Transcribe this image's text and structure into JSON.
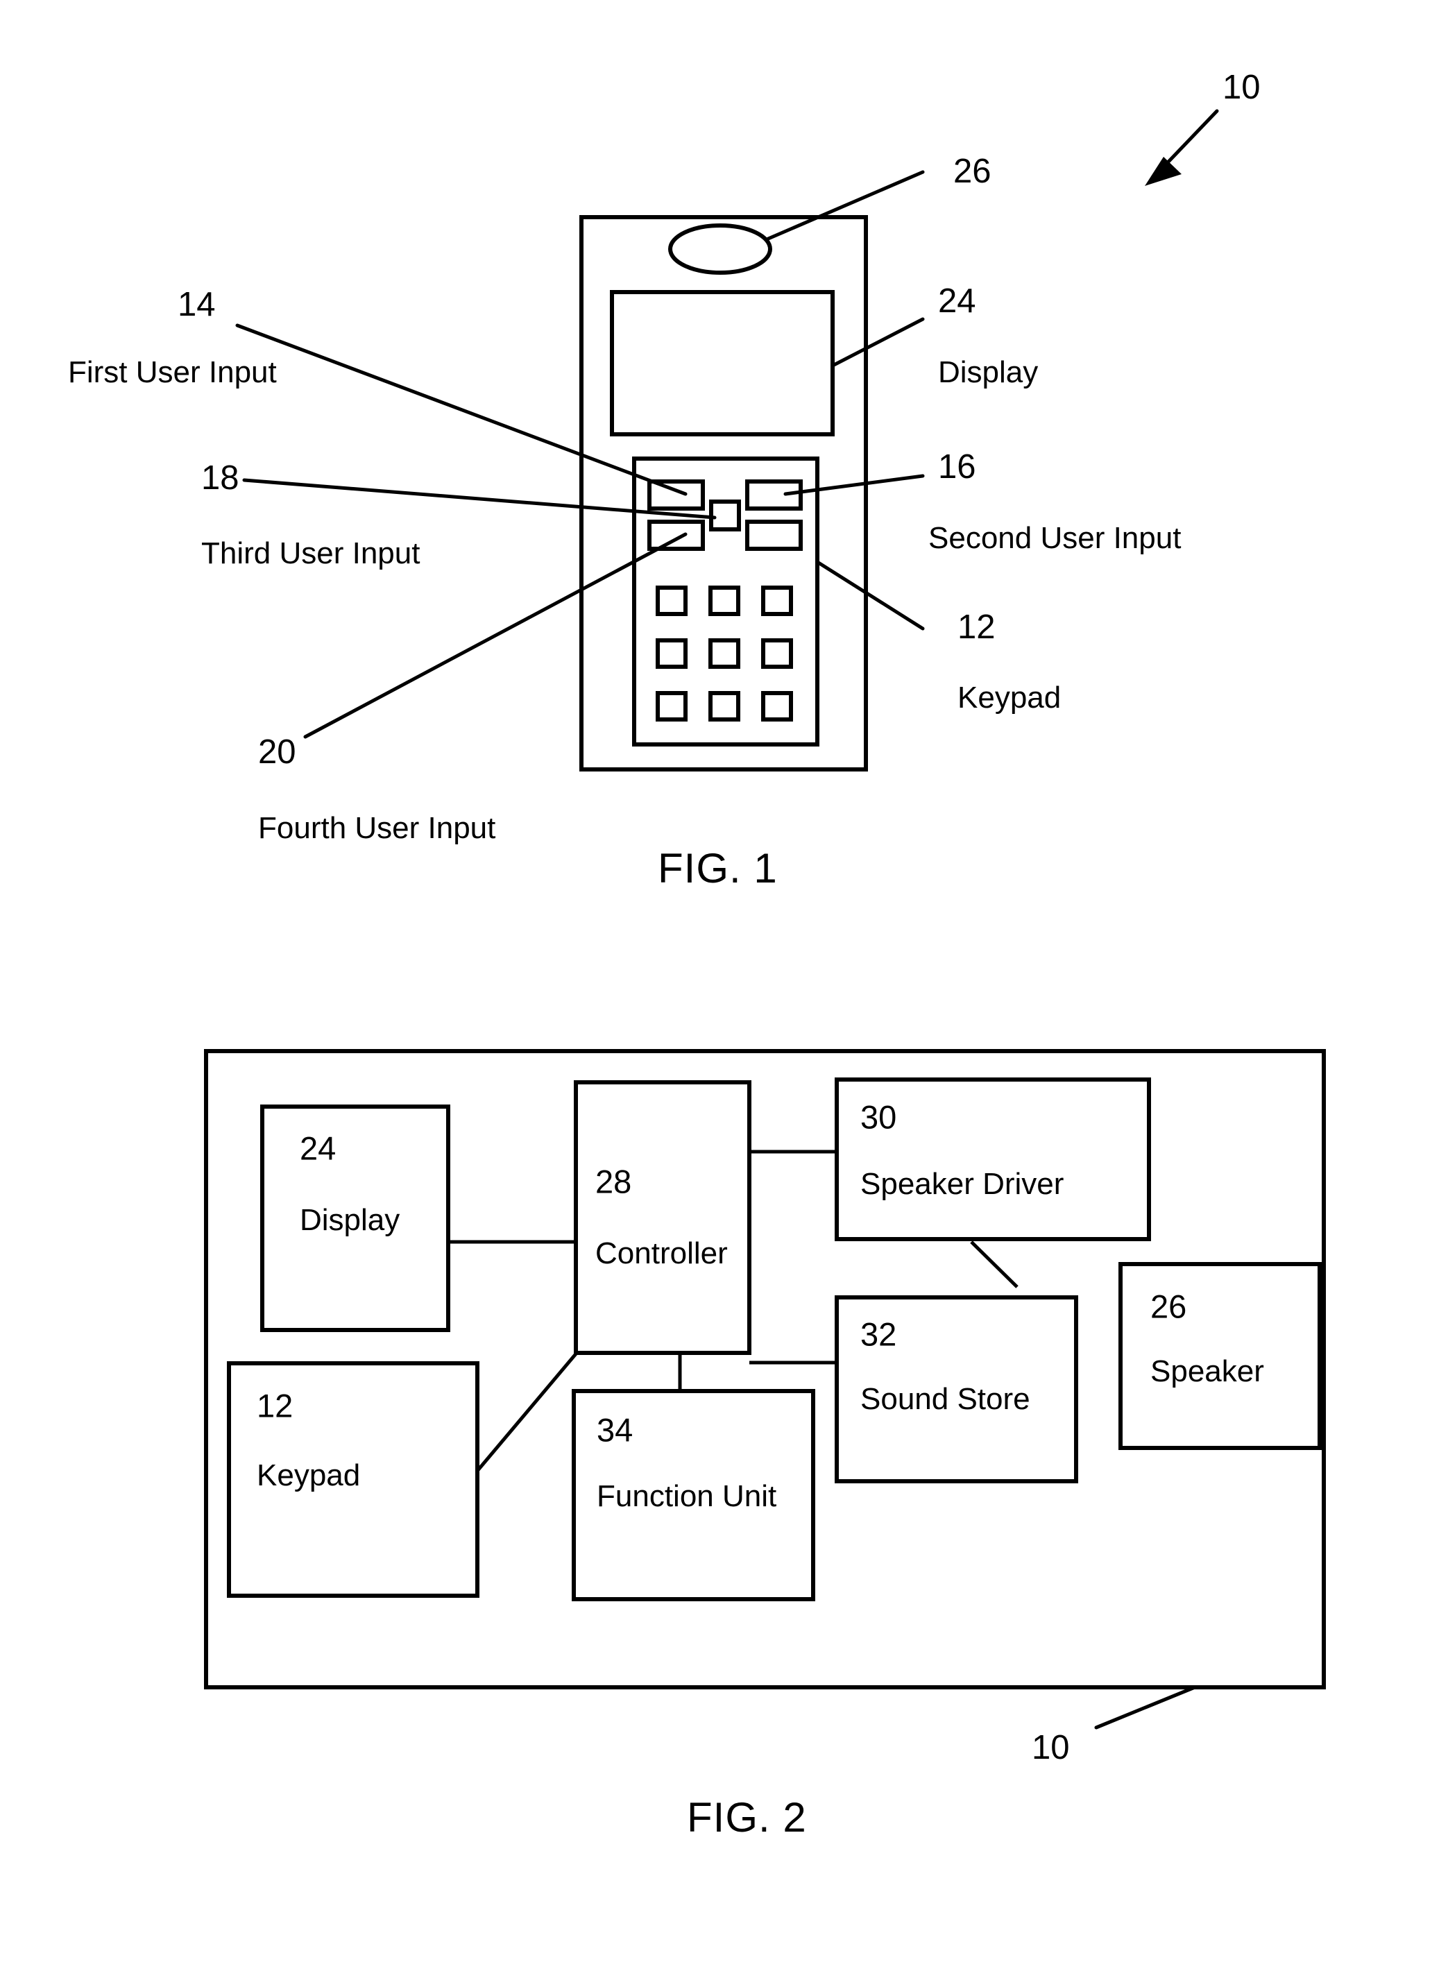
{
  "document": {
    "type": "patent-drawing-sheet",
    "figures": [
      {
        "caption": "FIG. 1",
        "title": "Mobile device front view",
        "overall_ref": "10",
        "callouts": [
          {
            "ref": "14",
            "label": "First User Input"
          },
          {
            "ref": "18",
            "label": "Third User Input"
          },
          {
            "ref": "20",
            "label": "Fourth User Input"
          },
          {
            "ref": "24",
            "label": "Display"
          },
          {
            "ref": "16",
            "label": "Second User Input"
          },
          {
            "ref": "12",
            "label": "Keypad"
          },
          {
            "ref": "26",
            "label": ""
          }
        ]
      },
      {
        "caption": "FIG. 2",
        "title": "Block diagram",
        "overall_ref": "10",
        "blocks": [
          {
            "ref": "24",
            "label": "Display"
          },
          {
            "ref": "12",
            "label": "Keypad"
          },
          {
            "ref": "28",
            "label": "Controller"
          },
          {
            "ref": "30",
            "label": "Speaker Driver"
          },
          {
            "ref": "32",
            "label": "Sound Store"
          },
          {
            "ref": "34",
            "label": "Function Unit"
          },
          {
            "ref": "26",
            "label": "Speaker"
          }
        ],
        "connections": [
          {
            "from": "24",
            "to": "28"
          },
          {
            "from": "12",
            "to": "28"
          },
          {
            "from": "28",
            "to": "30"
          },
          {
            "from": "28",
            "to": "32"
          },
          {
            "from": "28",
            "to": "34"
          },
          {
            "from": "30",
            "to": "26"
          }
        ]
      }
    ]
  },
  "fig1": {
    "caption": "FIG. 1",
    "ref_overall": "10",
    "ref_speaker": "26",
    "ref_display": "24",
    "label_display": "Display",
    "ref_first_input": "14",
    "label_first_input": "First User Input",
    "ref_second_input": "16",
    "label_second_input": "Second User Input",
    "ref_third_input": "18",
    "label_third_input": "Third User Input",
    "ref_fourth_input": "20",
    "label_fourth_input": "Fourth User Input",
    "ref_keypad": "12",
    "label_keypad": "Keypad"
  },
  "fig2": {
    "caption": "FIG. 2",
    "ref_overall": "10",
    "display_ref": "24",
    "display_label": "Display",
    "keypad_ref": "12",
    "keypad_label": "Keypad",
    "controller_ref": "28",
    "controller_label": "Controller",
    "speaker_driver_ref": "30",
    "speaker_driver_label": "Speaker Driver",
    "sound_store_ref": "32",
    "sound_store_label": "Sound Store",
    "function_unit_ref": "34",
    "function_unit_label": "Function Unit",
    "speaker_ref": "26",
    "speaker_label": "Speaker"
  },
  "colors": {
    "ink": "#000000",
    "paper": "#ffffff"
  }
}
